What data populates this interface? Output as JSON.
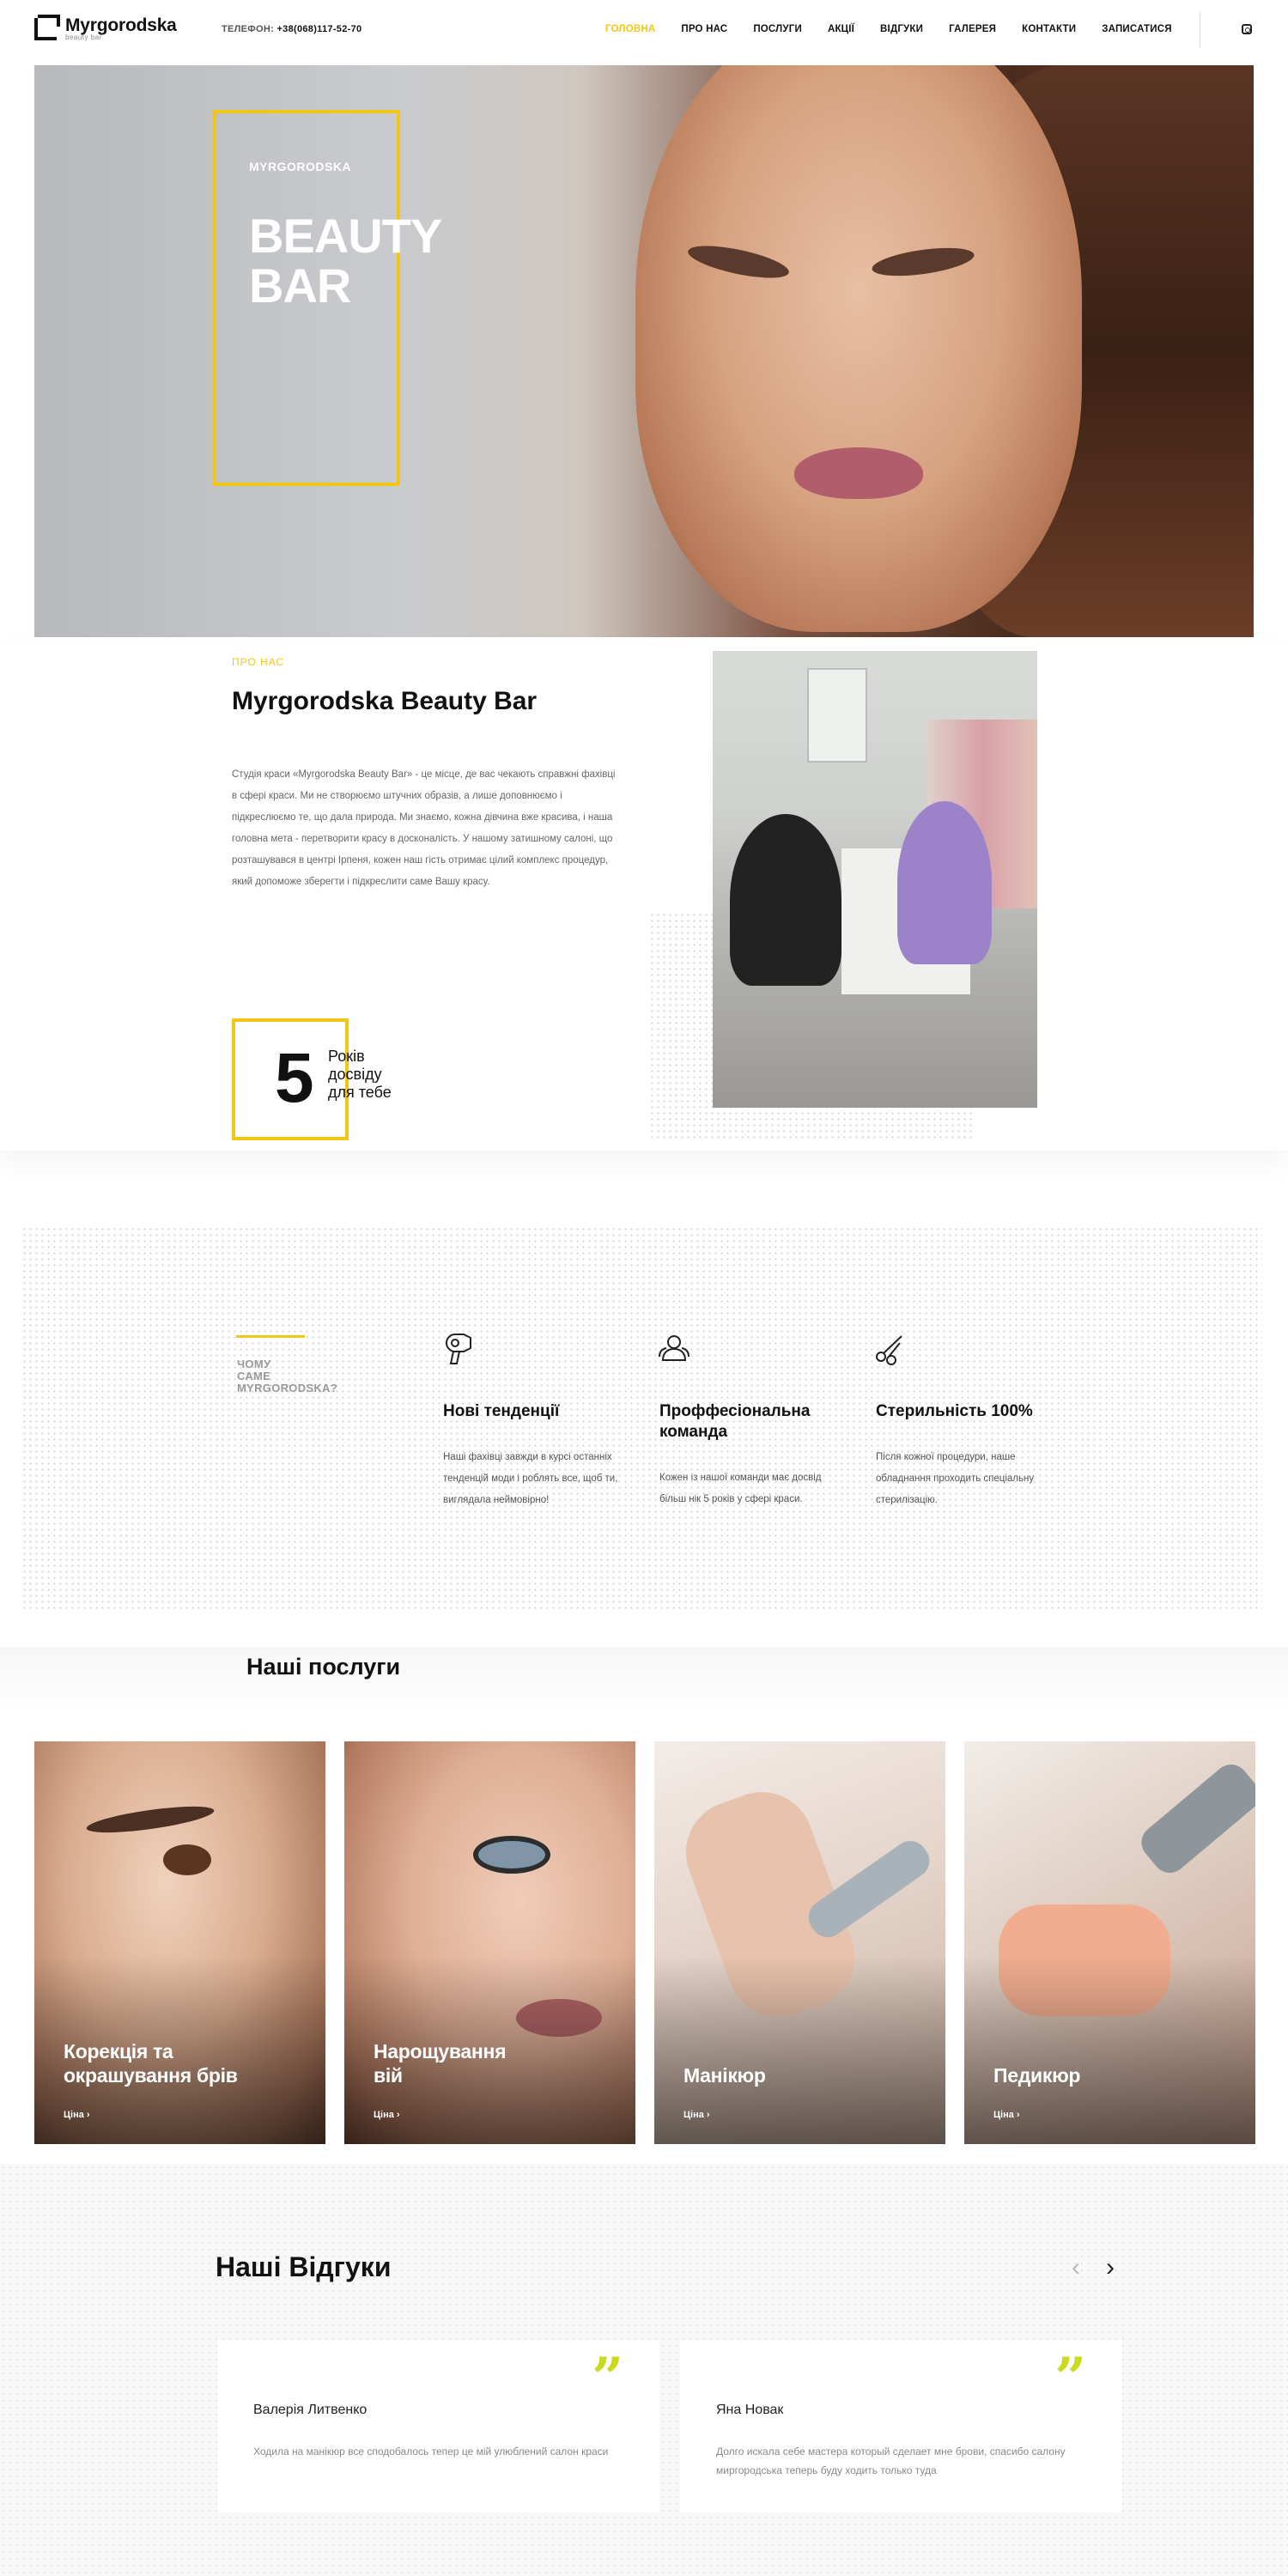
{
  "header": {
    "logo_title": "Myrgorodska",
    "logo_sub": "beauty bar",
    "phone_label": "ТЕЛЕФОН:",
    "phone_number": "+38(068)117-52-70",
    "nav": [
      "ГОЛОВНА",
      "ПРО НАС",
      "ПОСЛУГИ",
      "АКЦІЇ",
      "ВІДГУКИ",
      "ГАЛЕРЕЯ",
      "КОНТАКТИ",
      "ЗАПИСАТИСЯ"
    ],
    "active_color": "#f2c615"
  },
  "hero": {
    "kicker": "MYRGORODSKA",
    "title_line1": "BEAUTY",
    "title_line2": "BAR"
  },
  "about": {
    "kicker": "ПРО НАС",
    "title": "Myrgorodska Beauty Bar",
    "text": "Студія краси «Myrgorodska Beauty Bar» - це місце, де вас чекають справжні фахівці в сфері краси. Ми не створюємо штучних образів, а лише доповнюємо і підкреслюємо те, що дала природа. Ми знаємо, кожна дівчина вже красива, і наша головна мета - перетворити красу в досконалість. У нашому затишному салоні, що розташувався в центрі Ірпеня, кожен наш гість отримає цілий комплекс процедур, який допоможе зберегти і підкреслити саме Вашу красу.",
    "years_number": "5",
    "years_line1": "Років",
    "years_line2": "досвіду",
    "years_line3": "для тебе"
  },
  "why": {
    "label_line1": "ЧОМУ",
    "label_line2": "САМЕ",
    "label_line3": "MYRGORODSKA?",
    "features": [
      {
        "icon": "hair-dryer-icon",
        "title": "Нові тенденції",
        "text": "Наші фахівці завжди в курсі останніх тенденцій моди і роблять все, щоб ти, виглядала неймовірно!"
      },
      {
        "icon": "team-icon",
        "title": "Проффесіональна команда",
        "text": "Кожен із нашої команди має досвід більш нік 5 років у сфері краси."
      },
      {
        "icon": "scissors-icon",
        "title": "Стерильність 100%",
        "text": "Після кожної процедури, наше обладнання проходить спеціальну стерилізацію."
      }
    ]
  },
  "services": {
    "title": "Наші послуги",
    "price_label": "Ціна",
    "items": [
      {
        "title_line1": "Корекція та",
        "title_line2": "окрашування брів"
      },
      {
        "title_line1": "Нарощування",
        "title_line2": "вій"
      },
      {
        "title_line1": "Манікюр",
        "title_line2": ""
      },
      {
        "title_line1": "Педикюр",
        "title_line2": ""
      }
    ]
  },
  "reviews": {
    "title": "Наші Відгуки",
    "prev_arrow": "‹",
    "next_arrow": "›",
    "quote_glyph": "”",
    "items": [
      {
        "name": "Валерія Литвенко",
        "text": "Ходила на манікюр все сподобалось тепер це мій улюблений салон краси"
      },
      {
        "name": "Яна Новак",
        "text": "Долго искала себе мастера который сделает мне брови, спасибо салону миргородська теперь буду ходить только туда"
      }
    ]
  }
}
